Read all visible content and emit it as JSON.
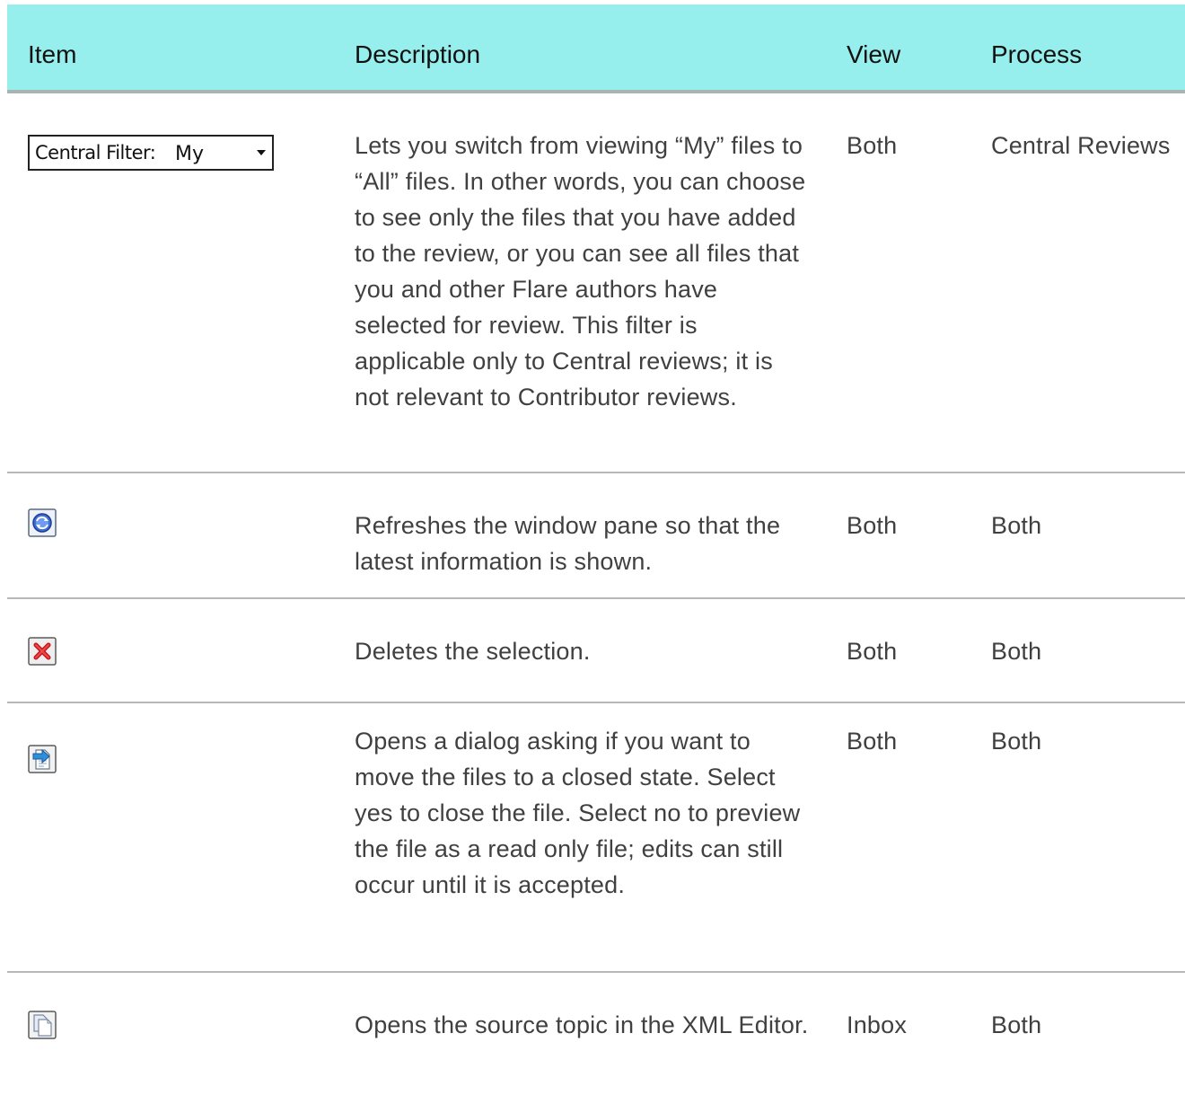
{
  "headers": {
    "item": "Item",
    "description": "Description",
    "view": "View",
    "process": "Process"
  },
  "rows": [
    {
      "icon": "central-filter-dropdown",
      "filter_label": "Central Filter:",
      "filter_value": "My",
      "description": "Lets you switch from viewing “My” files to “All” files. In other words, you can choose to see only the files that you have added to the review, or you can see all files that you and other Flare authors have selected for review. This filter is applicable only to Central reviews; it is not relevant to Contributor reviews.",
      "view": "Both",
      "process": "Central Reviews"
    },
    {
      "icon": "refresh-icon",
      "description": "Refreshes the window pane so that the latest information is shown.",
      "view": "Both",
      "process": "Both"
    },
    {
      "icon": "delete-icon",
      "description": "Deletes the selection.",
      "view": "Both",
      "process": "Both"
    },
    {
      "icon": "accept-file-icon",
      "description": "Opens a dialog asking if you want to move the files to a closed state. Select yes to close the file. Select no to preview the file as a read only file; edits can still occur until it is accepted.",
      "view": "Both",
      "process": "Both"
    },
    {
      "icon": "open-source-icon",
      "description": "Opens the source topic in the XML Editor.",
      "view": "Inbox",
      "process": "Both"
    }
  ]
}
